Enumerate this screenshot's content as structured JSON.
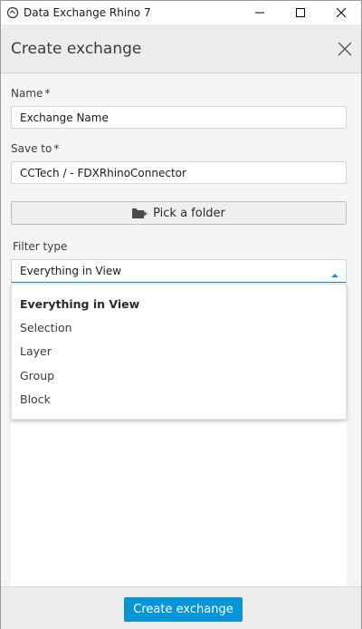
{
  "window": {
    "title": "Data Exchange Rhino 7",
    "app_icon": "cloud-exchange-icon",
    "controls": [
      "minimize-icon",
      "maximize-icon",
      "close-icon"
    ]
  },
  "header": {
    "title": "Create exchange",
    "close_icon": "close-icon"
  },
  "form": {
    "name": {
      "label": "Name",
      "required_marker": "*",
      "value": "Exchange Name"
    },
    "save_to": {
      "label": "Save to",
      "required_marker": "*",
      "value": "CCTech / - FDXRhinoConnector"
    },
    "pick_folder": {
      "label": "Pick a folder",
      "icon": "folder-add-icon"
    },
    "filter_type": {
      "label": "Filter type",
      "selected": "Everything in View",
      "options": [
        "Everything in View",
        "Selection",
        "Layer",
        "Group",
        "Block"
      ]
    }
  },
  "footer": {
    "create_label": "Create exchange"
  },
  "colors": {
    "accent": "#0696d7",
    "background": "#f5f5f5",
    "header_bg": "#ececec"
  }
}
